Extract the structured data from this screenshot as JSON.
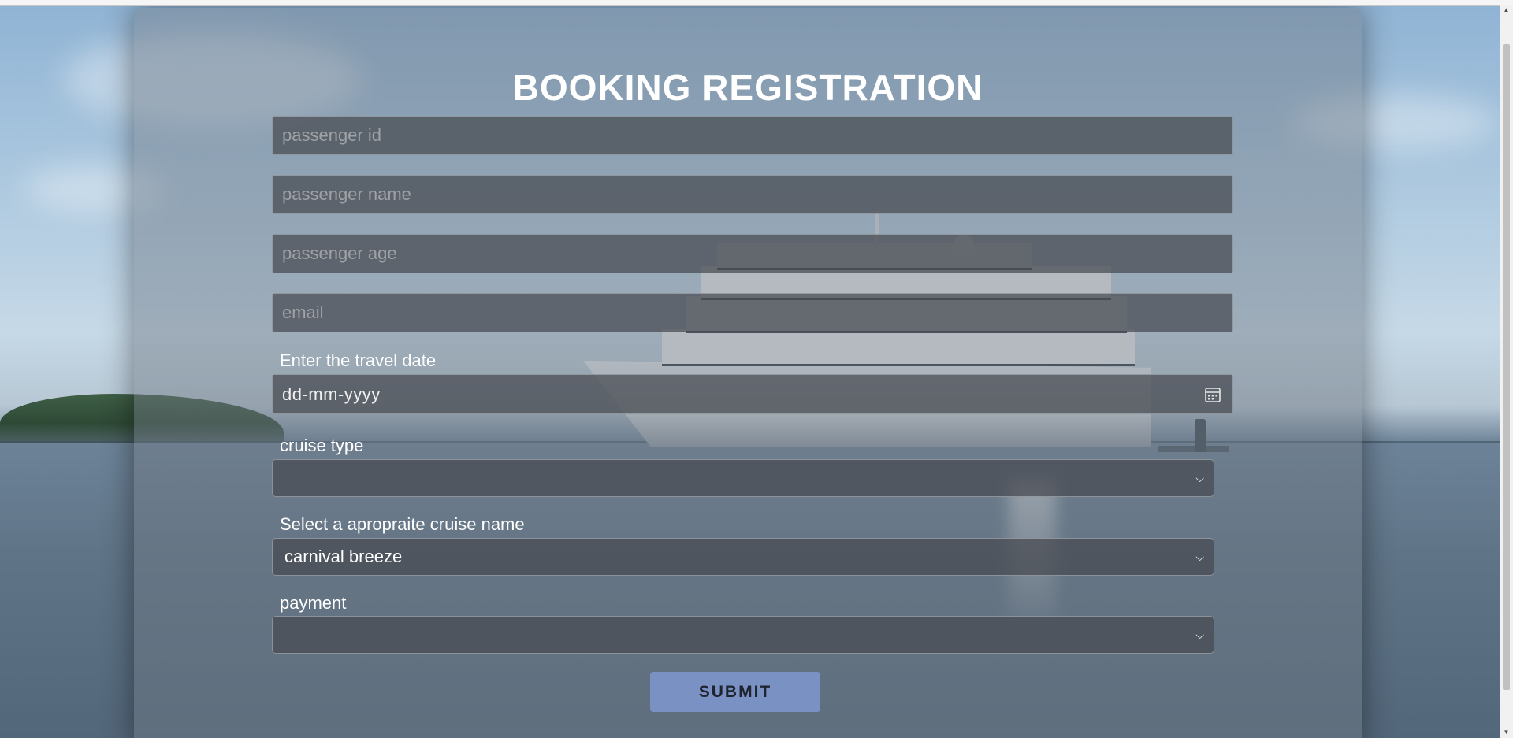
{
  "form": {
    "title": "BOOKING REGISTRATION",
    "fields": {
      "passenger_id": {
        "placeholder": "passenger id",
        "value": ""
      },
      "passenger_name": {
        "placeholder": "passenger name",
        "value": ""
      },
      "passenger_age": {
        "placeholder": "passenger age",
        "value": ""
      },
      "email": {
        "placeholder": "email",
        "value": ""
      }
    },
    "travel_date": {
      "label": "Enter the travel date",
      "value": "dd-mm-yyyy"
    },
    "cruise_type": {
      "label": "cruise type",
      "selected": ""
    },
    "cruise_name": {
      "label": "Select a apropraite cruise name",
      "selected": "carnival breeze"
    },
    "payment": {
      "label": "payment",
      "selected": ""
    },
    "submit_label": "SUBMIT"
  },
  "icons": {
    "date_picker": "calendar-icon",
    "select_arrow": "chevron-down-icon"
  },
  "colors": {
    "submit_bg": "#7a91c4",
    "title_text": "#ffffff"
  }
}
